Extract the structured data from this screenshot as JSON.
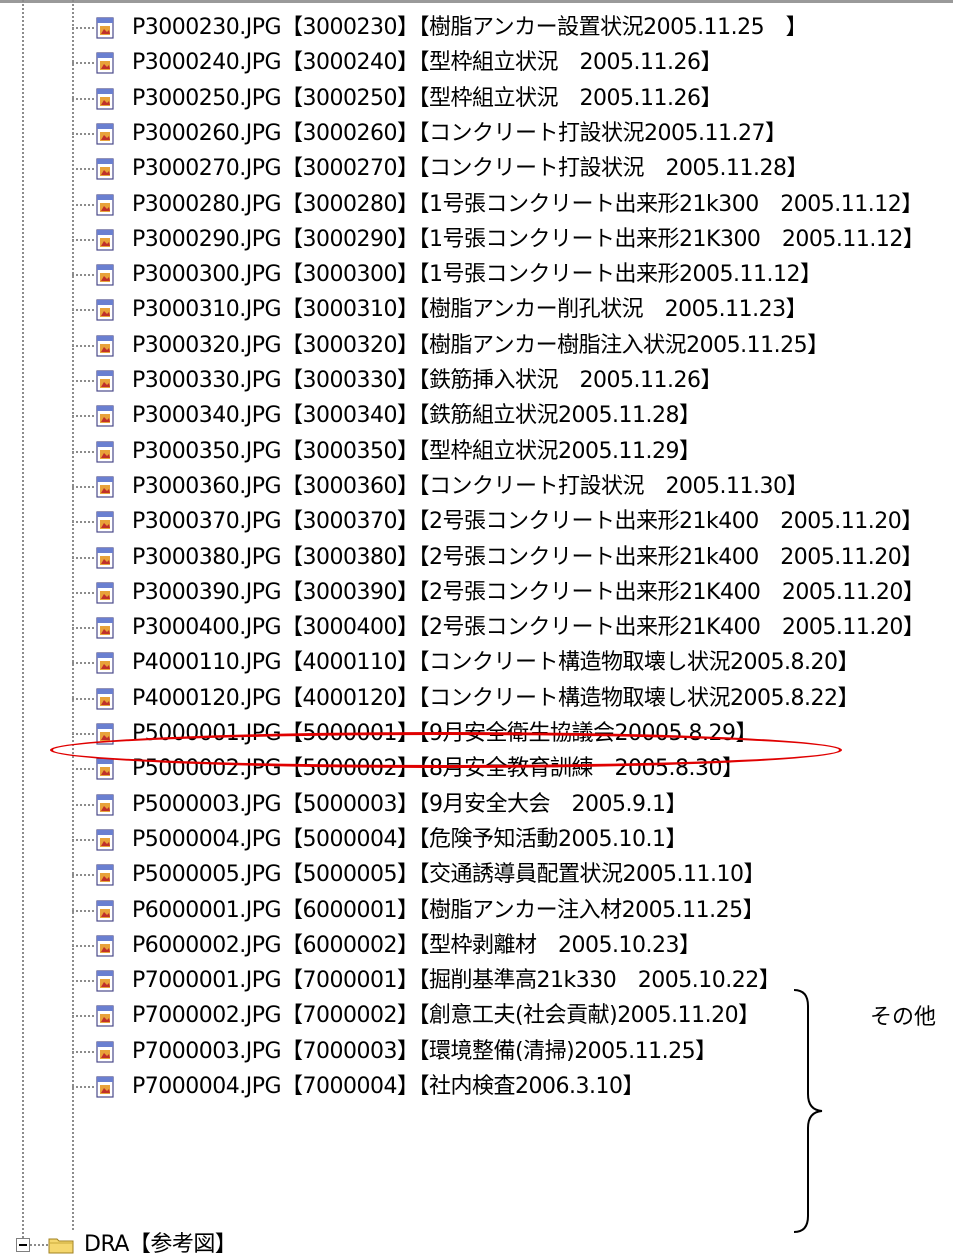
{
  "tree": {
    "items": [
      {
        "label": "P3000230.JPG【3000230】【樹脂アンカー設置状況2005.11.25　】"
      },
      {
        "label": "P3000240.JPG【3000240】【型枠組立状況　2005.11.26】"
      },
      {
        "label": "P3000250.JPG【3000250】【型枠組立状況　2005.11.26】"
      },
      {
        "label": "P3000260.JPG【3000260】【コンクリート打設状況2005.11.27】"
      },
      {
        "label": "P3000270.JPG【3000270】【コンクリート打設状況　2005.11.28】"
      },
      {
        "label": "P3000280.JPG【3000280】【1号張コンクリート出来形21k300　2005.11.12】"
      },
      {
        "label": "P3000290.JPG【3000290】【1号張コンクリート出来形21K300　2005.11.12】"
      },
      {
        "label": "P3000300.JPG【3000300】【1号張コンクリート出来形2005.11.12】"
      },
      {
        "label": "P3000310.JPG【3000310】【樹脂アンカー削孔状況　2005.11.23】"
      },
      {
        "label": "P3000320.JPG【3000320】【樹脂アンカー樹脂注入状況2005.11.25】"
      },
      {
        "label": "P3000330.JPG【3000330】【鉄筋挿入状況　2005.11.26】"
      },
      {
        "label": "P3000340.JPG【3000340】【鉄筋組立状況2005.11.28】"
      },
      {
        "label": "P3000350.JPG【3000350】【型枠組立状況2005.11.29】"
      },
      {
        "label": "P3000360.JPG【3000360】【コンクリート打設状況　2005.11.30】"
      },
      {
        "label": "P3000370.JPG【3000370】【2号張コンクリート出来形21k400　2005.11.20】"
      },
      {
        "label": "P3000380.JPG【3000380】【2号張コンクリート出来形21k400　2005.11.20】"
      },
      {
        "label": "P3000390.JPG【3000390】【2号張コンクリート出来形21K400　2005.11.20】"
      },
      {
        "label": "P3000400.JPG【3000400】【2号張コンクリート出来形21K400　2005.11.20】"
      },
      {
        "label": "P4000110.JPG【4000110】【コンクリート構造物取壊し状況2005.8.20】"
      },
      {
        "label": "P4000120.JPG【4000120】【コンクリート構造物取壊し状況2005.8.22】"
      },
      {
        "label": "P5000001.JPG【5000001】【9月安全衛生協議会20005.8.29】"
      },
      {
        "label": "P5000002.JPG【5000002】【8月安全教育訓練　2005.8.30】"
      },
      {
        "label": "P5000003.JPG【5000003】【9月安全大会　2005.9.1】"
      },
      {
        "label": "P5000004.JPG【5000004】【危険予知活動2005.10.1】"
      },
      {
        "label": "P5000005.JPG【5000005】【交通誘導員配置状況2005.11.10】"
      },
      {
        "label": "P6000001.JPG【6000001】【樹脂アンカー注入材2005.11.25】"
      },
      {
        "label": "P6000002.JPG【6000002】【型枠剥離材　2005.10.23】"
      },
      {
        "label": "P7000001.JPG【7000001】【掘削基準高21k330　2005.10.22】"
      },
      {
        "label": "P7000002.JPG【7000002】【創意工夫(社会貢献)2005.11.20】"
      },
      {
        "label": "P7000003.JPG【7000003】【環境整備(清掃)2005.11.25】"
      },
      {
        "label": "P7000004.JPG【7000004】【社内検査2006.3.10】"
      }
    ],
    "folder": {
      "label": "DRA【参考図】",
      "icon": "folder-icon"
    },
    "file_icon": "jpg-file-icon"
  },
  "annotation": {
    "group_label": "その他",
    "highlight_color": "#e00000",
    "highlighted_item": "P5000005.JPG"
  }
}
